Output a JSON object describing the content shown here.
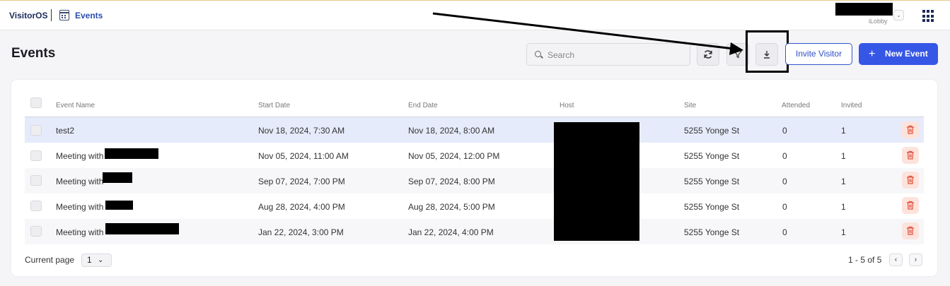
{
  "topbar": {
    "brand": "VisitorOS",
    "breadcrumb": "Events",
    "org": "iLobby"
  },
  "page": {
    "title": "Events"
  },
  "toolbar": {
    "search_placeholder": "Search",
    "invite_label": "Invite Visitor",
    "new_event_label": "New Event",
    "new_event_icon": "+"
  },
  "table": {
    "headers": [
      "Event Name",
      "Start Date",
      "End Date",
      "Host",
      "Site",
      "Attended",
      "Invited"
    ],
    "rows": [
      {
        "name": "test2",
        "start": "Nov 18, 2024, 7:30 AM",
        "end": "Nov 18, 2024, 8:00 AM",
        "site": "5255 Yonge St",
        "attended": "0",
        "invited": "1"
      },
      {
        "name": "Meeting with",
        "start": "Nov 05, 2024, 11:00 AM",
        "end": "Nov 05, 2024, 12:00 PM",
        "site": "5255 Yonge St",
        "attended": "0",
        "invited": "1"
      },
      {
        "name": "Meeting with",
        "start": "Sep 07, 2024, 7:00 PM",
        "end": "Sep 07, 2024, 8:00 PM",
        "site": "5255 Yonge St",
        "attended": "0",
        "invited": "1"
      },
      {
        "name": "Meeting with",
        "start": "Aug 28, 2024, 4:00 PM",
        "end": "Aug 28, 2024, 5:00 PM",
        "site": "5255 Yonge St",
        "attended": "0",
        "invited": "1"
      },
      {
        "name": "Meeting with",
        "start": "Jan 22, 2024, 3:00 PM",
        "end": "Jan 22, 2024, 4:00 PM",
        "site": "5255 Yonge St",
        "attended": "0",
        "invited": "1"
      }
    ]
  },
  "footer": {
    "current_page_label": "Current page",
    "current_page": "1",
    "range": "1 - 5 of 5"
  },
  "colors": {
    "primary": "#3656e6",
    "selected_row": "#e6ebfb",
    "delete_bg": "#fde3dc",
    "delete_icon": "#e0503a"
  },
  "icons": {
    "calendar": "calendar-icon",
    "apps": "apps-grid-icon",
    "search": "search-icon",
    "refresh": "refresh-icon",
    "filter": "filter-icon",
    "download": "download-icon",
    "delete": "trash-icon"
  }
}
